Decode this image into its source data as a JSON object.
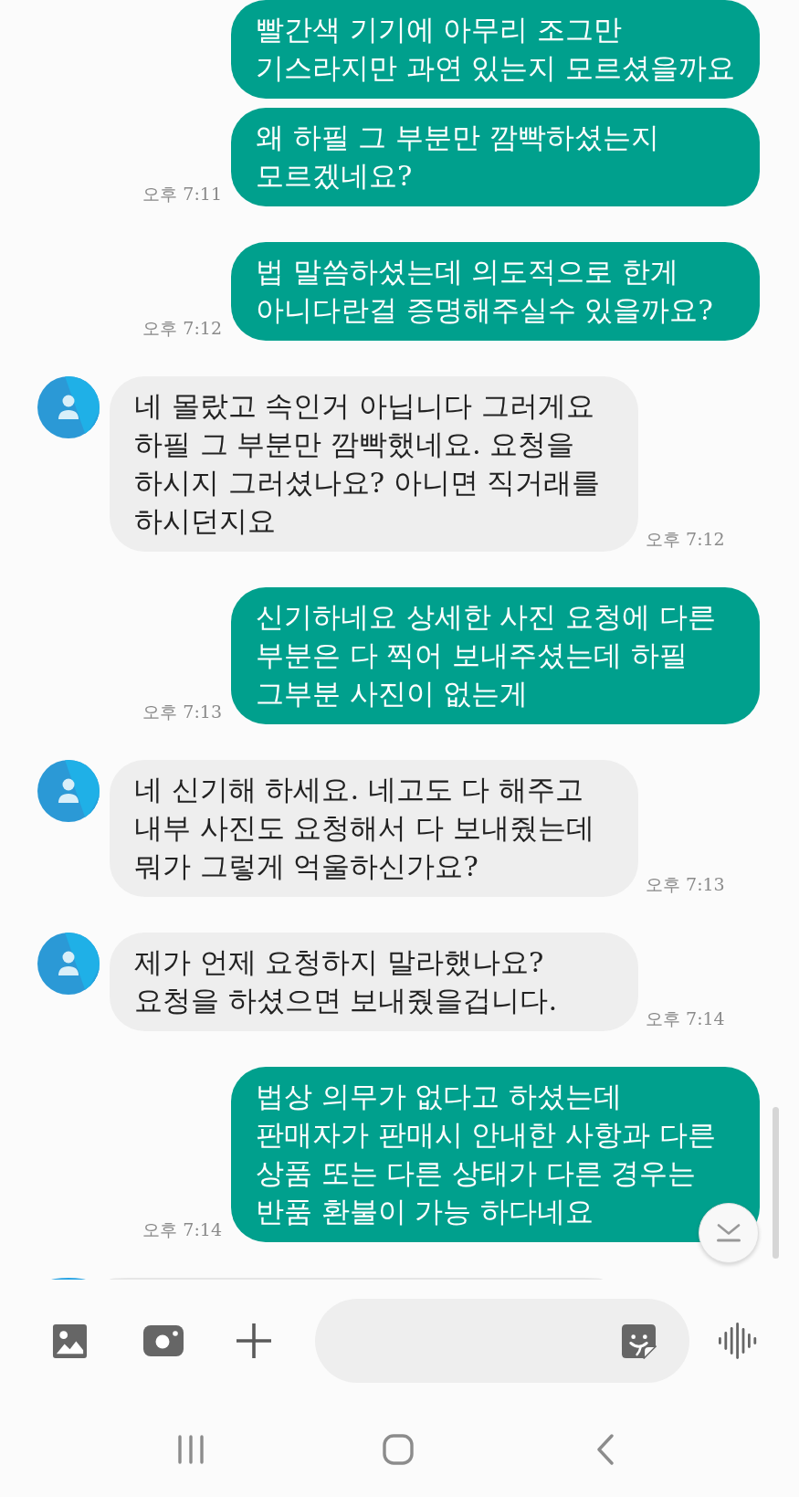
{
  "messages": [
    {
      "kind": "sent",
      "text": "빨간색 기기에 아무리 조그만\n기스라지만 과연 있는지 모르셨을까요"
    },
    {
      "kind": "sent",
      "text": "왜 하필 그 부분만 깜빡하셨는지\n모르겠네요?",
      "time": "오후 7:11"
    },
    {
      "kind": "sent",
      "text": "법 말씀하셨는데 의도적으로 한게\n아니다란걸 증명해주실수 있을까요?",
      "time": "오후 7:12"
    },
    {
      "kind": "received",
      "text": "네 몰랐고 속인거 아닙니다 그러게요\n하필 그 부분만 깜빡했네요. 요청을\n하시지 그러셨나요? 아니면 직거래를\n하시던지요",
      "time": "오후 7:12"
    },
    {
      "kind": "sent",
      "text": "신기하네요 상세한 사진 요청에 다른\n부분은 다 찍어 보내주셨는데 하필\n그부분 사진이 없는게",
      "time": "오후 7:13"
    },
    {
      "kind": "received",
      "text": "네 신기해 하세요. 네고도 다 해주고\n내부 사진도 요청해서 다 보내줬는데\n뭐가 그렇게 억울하신가요?",
      "time": "오후 7:13"
    },
    {
      "kind": "received",
      "text": "제가 언제 요청하지 말라했나요?\n요청을 하셨으면 보내줬을겁니다.",
      "time": "오후 7:14"
    },
    {
      "kind": "sent",
      "text": "법상 의무가 없다고 하셨는데\n판매자가 판매시 안내한 사항과 다른\n상품 또는 다른 상태가 다른 경우는\n반품 환불이 가능 하다네요",
      "time": "오후 7:14"
    },
    {
      "kind": "received",
      "cut": true
    }
  ]
}
